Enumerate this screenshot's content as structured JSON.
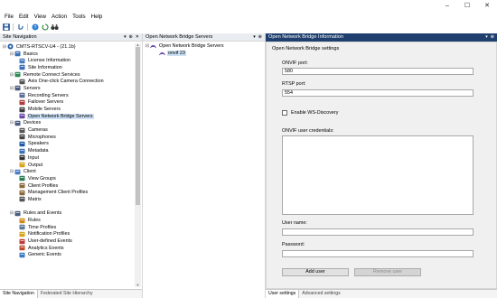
{
  "window": {
    "minimize": "–",
    "maximize": "☐",
    "close": "✕"
  },
  "menu": [
    "File",
    "Edit",
    "View",
    "Action",
    "Tools",
    "Help"
  ],
  "toolbar": [
    "save-icon",
    "undo-icon",
    "help-icon",
    "refresh-icon",
    "binoculars-icon"
  ],
  "site_navigation": {
    "title": "Site Navigation",
    "controls": [
      "▾",
      "⊕",
      "✕"
    ],
    "server": "CMTS-RTSCV-U4 - (21.1b)",
    "tree": [
      {
        "depth": 1,
        "expander": "⊟",
        "icon": "book",
        "label": "Basics"
      },
      {
        "depth": 2,
        "expander": "",
        "icon": "license",
        "label": "License Information"
      },
      {
        "depth": 2,
        "expander": "",
        "icon": "info",
        "label": "Site Information"
      },
      {
        "depth": 1,
        "expander": "⊟",
        "icon": "remote",
        "label": "Remote Connect Services"
      },
      {
        "depth": 2,
        "expander": "",
        "icon": "camera",
        "label": "Axis One-click Camera Connection"
      },
      {
        "depth": 1,
        "expander": "⊟",
        "icon": "servers",
        "label": "Servers"
      },
      {
        "depth": 2,
        "expander": "",
        "icon": "server",
        "label": "Recording Servers"
      },
      {
        "depth": 2,
        "expander": "",
        "icon": "failover",
        "label": "Failover Servers"
      },
      {
        "depth": 2,
        "expander": "",
        "icon": "mobile",
        "label": "Mobile Servers"
      },
      {
        "depth": 2,
        "expander": "",
        "icon": "bridge",
        "label": "Open Network Bridge Servers",
        "selected": true
      },
      {
        "depth": 1,
        "expander": "⊟",
        "icon": "devices",
        "label": "Devices"
      },
      {
        "depth": 2,
        "expander": "",
        "icon": "camera",
        "label": "Cameras"
      },
      {
        "depth": 2,
        "expander": "",
        "icon": "mic",
        "label": "Microphones"
      },
      {
        "depth": 2,
        "expander": "",
        "icon": "speaker",
        "label": "Speakers"
      },
      {
        "depth": 2,
        "expander": "",
        "icon": "metadata",
        "label": "Metadata"
      },
      {
        "depth": 2,
        "expander": "",
        "icon": "input",
        "label": "Input"
      },
      {
        "depth": 2,
        "expander": "",
        "icon": "output",
        "label": "Output"
      },
      {
        "depth": 1,
        "expander": "⊟",
        "icon": "client",
        "label": "Client"
      },
      {
        "depth": 2,
        "expander": "",
        "icon": "viewgroups",
        "label": "View Groups"
      },
      {
        "depth": 2,
        "expander": "",
        "icon": "profile",
        "label": "Client Profiles"
      },
      {
        "depth": 2,
        "expander": "",
        "icon": "profile",
        "label": "Management Client Profiles"
      },
      {
        "depth": 2,
        "expander": "",
        "icon": "matrix",
        "label": "Matrix"
      },
      {
        "depth": 1,
        "expander": "",
        "icon": "",
        "label": ""
      },
      {
        "depth": 1,
        "expander": "⊟",
        "icon": "rules",
        "label": "Rules and Events"
      },
      {
        "depth": 2,
        "expander": "",
        "icon": "rule",
        "label": "Rules"
      },
      {
        "depth": 2,
        "expander": "",
        "icon": "time",
        "label": "Time Profiles"
      },
      {
        "depth": 2,
        "expander": "",
        "icon": "notify",
        "label": "Notification Profiles"
      },
      {
        "depth": 2,
        "expander": "",
        "icon": "event",
        "label": "User-defined Events"
      },
      {
        "depth": 2,
        "expander": "",
        "icon": "analytics",
        "label": "Analytics Events"
      },
      {
        "depth": 2,
        "expander": "",
        "icon": "generic",
        "label": "Generic Events"
      }
    ],
    "tabs": [
      "Site Navigation",
      "Federated Site Hierarchy"
    ]
  },
  "bridge_servers": {
    "title": "Open Network Bridge Servers",
    "controls": [
      "▾",
      "⊕"
    ],
    "root": "Open Network Bridge Servers",
    "child": "onvif 23"
  },
  "bridge_info": {
    "title": "Open Network Bridge Information",
    "controls": [
      "▾",
      "⊕"
    ],
    "settings_title": "Open Network Bridge settings",
    "onvif_port_label": "ONVIF port:",
    "onvif_port_value": "580",
    "rtsp_port_label": "RTSP port:",
    "rtsp_port_value": "554",
    "ws_discovery_label": "Enable WS-Discovery",
    "credentials_label": "ONVIF user credentials:",
    "username_label": "User name:",
    "username_value": "",
    "password_label": "Password:",
    "password_value": "",
    "add_user": "Add user",
    "remove_user": "Remove user",
    "tabs": [
      "User settings",
      "Advanced settings"
    ]
  },
  "colors": {
    "header_dark": "#1f3f6e",
    "selection": "#cce0f5",
    "panel_bg": "#f0f0f0"
  }
}
